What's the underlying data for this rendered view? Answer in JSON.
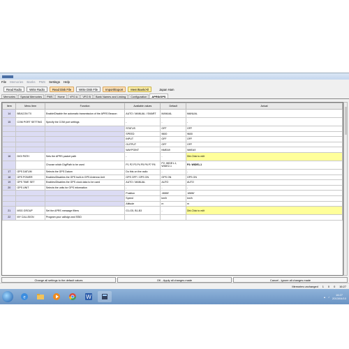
{
  "window": {
    "title": "",
    "menu": [
      {
        "label": "File",
        "dim": false
      },
      {
        "label": "Memories",
        "dim": true
      },
      {
        "label": "Banks",
        "dim": true
      },
      {
        "label": "PMS",
        "dim": true
      },
      {
        "label": "Settings",
        "dim": false
      },
      {
        "label": "Help",
        "dim": false
      }
    ]
  },
  "toolbar": {
    "read_radio": "Read Radio",
    "write_radio": "Write Radio",
    "read_disk": "Read Disk File",
    "write_disk": "Write Disk File",
    "import_export": "Import/Export",
    "mem_bank_all": "Mem/Bank/All",
    "model": "Japan Ham"
  },
  "tabs": [
    {
      "label": "Memories",
      "active": false
    },
    {
      "label": "Special Memories",
      "active": false
    },
    {
      "label": "PMS",
      "active": false
    },
    {
      "label": "Home",
      "active": false
    },
    {
      "label": "VFO A",
      "active": false
    },
    {
      "label": "VFO B",
      "active": false
    },
    {
      "label": "Bank Names and Linking",
      "active": false
    },
    {
      "label": "Configuration",
      "active": false
    },
    {
      "label": "APRS/GPS",
      "active": true
    }
  ],
  "table": {
    "headers": [
      "Item",
      "Menu Item",
      "Function",
      "Available values",
      "Default",
      "Actual"
    ],
    "rows": [
      {
        "item": "14",
        "menu": "BEACON TX",
        "func": "Enable/Disable the automatic transmission of the APRS Beacon",
        "avail": "AUTO / MANUAL / SMART",
        "def": "MANUAL",
        "actual": "MANUAL",
        "type": "tall"
      },
      {
        "item": "15",
        "menu": "COM PORT SETTING",
        "func": "Specify the COM port settings",
        "avail": "-",
        "def": "-",
        "actual": "-",
        "type": "tall"
      },
      {
        "item": "",
        "menu": "",
        "func": "",
        "avail": "STATUS",
        "def": "OFF",
        "actual": "OFF",
        "type": "sub"
      },
      {
        "item": "",
        "menu": "",
        "func": "",
        "avail": "SPEED",
        "def": "9600",
        "actual": "9600",
        "type": "sub"
      },
      {
        "item": "",
        "menu": "",
        "func": "",
        "avail": "INPUT",
        "def": "OFF",
        "actual": "OFF",
        "type": "sub"
      },
      {
        "item": "",
        "menu": "",
        "func": "",
        "avail": "OUTPUT",
        "def": "OFF",
        "actual": "OFF",
        "type": "sub"
      },
      {
        "item": "",
        "menu": "",
        "func": "",
        "avail": "WAYPOINT",
        "def": "NMEA9",
        "actual": "NMEA9",
        "type": "sub"
      },
      {
        "item": "16",
        "menu": "DIGI PATH",
        "func": "Sets the APRS packet path",
        "avail": "-",
        "def": "-",
        "actual": "Dbl-Click to edit",
        "type": "yellow"
      },
      {
        "item": "",
        "menu": "",
        "func": "Choose which DigiPath to be used",
        "avail": "P1 P2 P3 P4 P5 P6 P7 P8",
        "def": "P2: WIDE1-1, WIDE2-1",
        "actual": "P2: WIDE1-1",
        "type": "digi"
      },
      {
        "item": "17",
        "menu": "GPS DATUM",
        "func": "Selects the GPS Datum",
        "avail": "Do this on the radio",
        "def": "-",
        "actual": "-",
        "type": "normal"
      },
      {
        "item": "18",
        "menu": "GPS POWER",
        "func": "Enables/Disables the GPS built-in GPS Antenna Unit",
        "avail": "GPS OFF / GPS ON",
        "def": "GPS ON",
        "actual": "GPS ON",
        "type": "normal"
      },
      {
        "item": "19",
        "menu": "GPS TIME SET",
        "func": "Enables/Disables the GPS clock data to be used",
        "avail": "AUTO / MANUAL",
        "def": "AUTO",
        "actual": "AUTO",
        "type": "normal"
      },
      {
        "item": "20",
        "menu": "GPS UNIT",
        "func": "Selects the units for GPS information",
        "avail": "-",
        "def": "-",
        "actual": "-",
        "type": "normal"
      },
      {
        "item": "",
        "menu": "",
        "func": "",
        "avail": "Position",
        "def": ".MMM'",
        "actual": ".MMM'",
        "type": "sub"
      },
      {
        "item": "",
        "menu": "",
        "func": "",
        "avail": "Speed",
        "def": "km/h",
        "actual": "km/h",
        "type": "sub"
      },
      {
        "item": "",
        "menu": "",
        "func": "",
        "avail": "Altitude",
        "def": "m",
        "actual": "m",
        "type": "sub"
      },
      {
        "item": "21",
        "menu": "MSG GROUP",
        "func": "Set the APRS message filters",
        "avail": "G1-G5, B1-B3",
        "def": "-",
        "actual": "Dbl-Click to edit",
        "type": "yellow"
      },
      {
        "item": "22",
        "menu": "MY CALLSIGN",
        "func": "Program your callsign and SSID",
        "avail": "",
        "def": "",
        "actual": "",
        "type": "normal"
      }
    ]
  },
  "bottom_buttons": {
    "reset": "Change all settings to the default values",
    "ok": "OK - Apply all changes made",
    "cancel": "Cancel - Ignore all changes made"
  },
  "status": {
    "memories": "Memories unchanged",
    "n1": "1",
    "n2": "0",
    "n3": "0",
    "time": "16:27"
  },
  "taskbar": {
    "clock_time": "16:27",
    "clock_date": "2013/04/10",
    "bg_color": "#6b94c4"
  }
}
